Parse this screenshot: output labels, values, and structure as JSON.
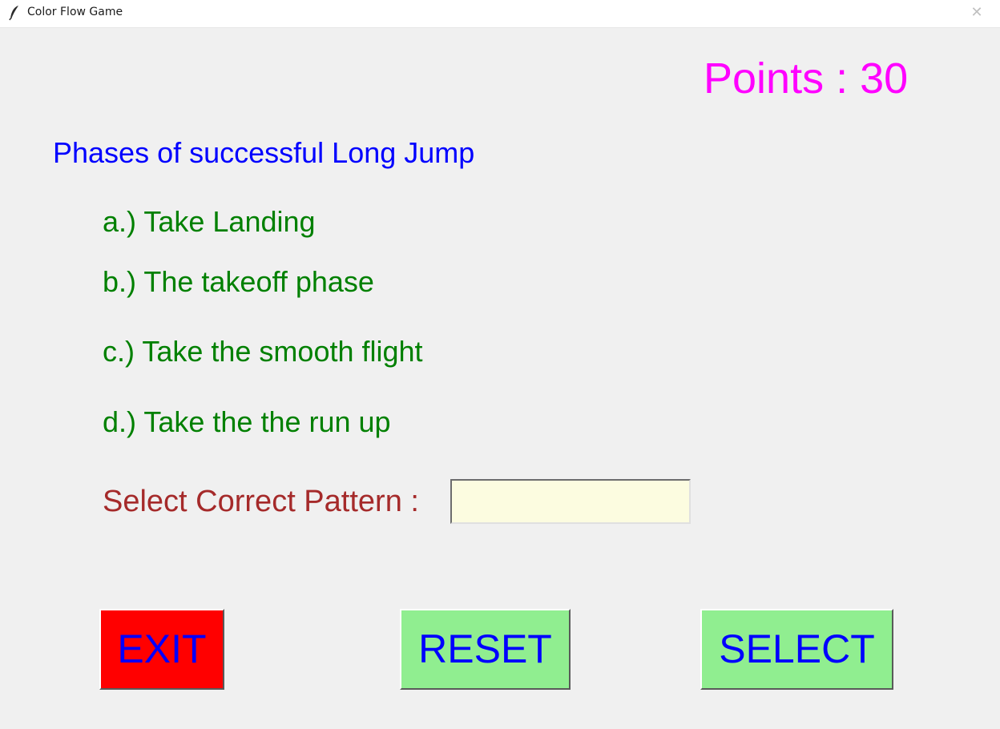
{
  "window": {
    "title": "Color Flow Game",
    "app_icon": "feather-icon",
    "close_icon": "close-icon",
    "close_glyph": "✕"
  },
  "score": {
    "text": "Points : 30"
  },
  "question": {
    "title": "Phases of successful Long Jump",
    "options": [
      "a.) Take Landing",
      "b.) The takeoff phase",
      "c.) Take the smooth flight",
      "d.) Take the the run up"
    ]
  },
  "answer": {
    "prompt": "Select Correct Pattern :",
    "value": ""
  },
  "buttons": {
    "exit": "EXIT",
    "reset": "RESET",
    "select": "SELECT"
  },
  "colors": {
    "points": "#ff00ff",
    "question": "#0000ff",
    "options": "#008000",
    "prompt": "#a52a2a",
    "button_text": "#0000ff",
    "exit_bg": "#ff0000",
    "action_bg": "#90ee90",
    "input_bg": "#fcfce0"
  }
}
